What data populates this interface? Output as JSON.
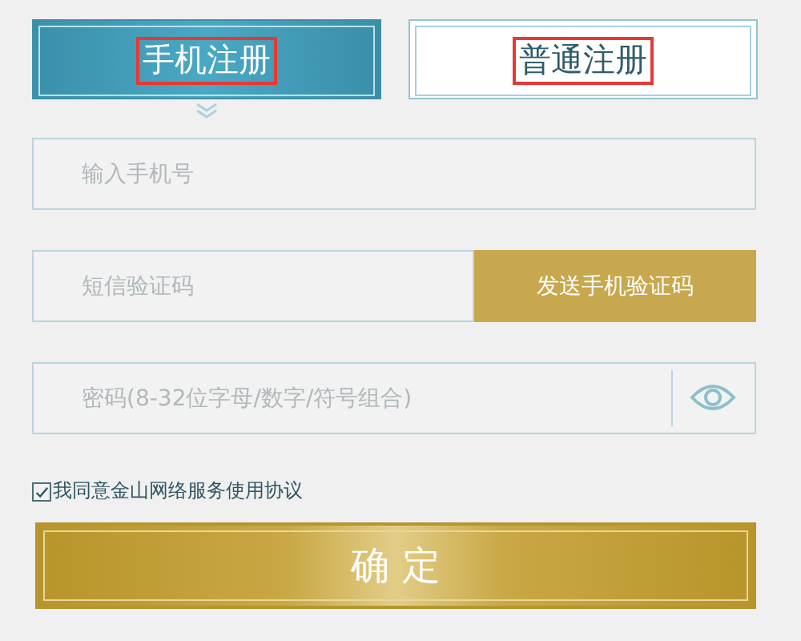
{
  "tabs": [
    {
      "label": "手机注册",
      "selected": true,
      "highlighted": true
    },
    {
      "label": "普通注册",
      "selected": false,
      "highlighted": true
    }
  ],
  "phone_field": {
    "placeholder": "输入手机号"
  },
  "code_field": {
    "placeholder": "短信验证码"
  },
  "send_code_button": "发送手机验证码",
  "password_field": {
    "placeholder": "密码(8-32位字母/数字/符号组合)"
  },
  "agreement": {
    "label": "我同意金山网络服务使用协议",
    "checked": true
  },
  "confirm_button": "确 定"
}
